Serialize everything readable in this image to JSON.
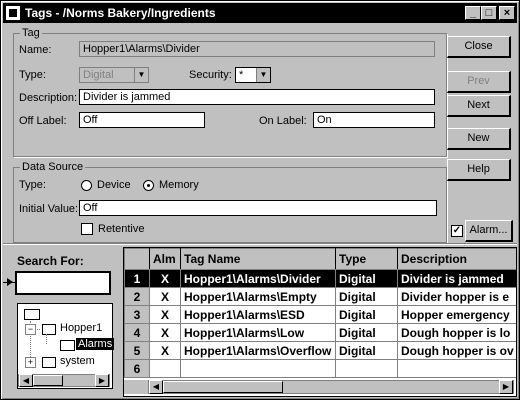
{
  "window": {
    "title": "Tags - /Norms Bakery/Ingredients",
    "minimize": "_",
    "maximize": "□",
    "close": "×"
  },
  "tag_group": {
    "title": "Tag",
    "name_label": "Name:",
    "name_value": "Hopper1\\Alarms\\Divider",
    "type_label": "Type:",
    "type_value": "Digital",
    "security_label": "Security:",
    "security_value": "*",
    "description_label": "Description:",
    "description_value": "Divider is jammed",
    "off_label": "Off Label:",
    "off_value": "Off",
    "on_label": "On Label:",
    "on_value": "On"
  },
  "data_source": {
    "title": "Data Source",
    "type_label": "Type:",
    "device_label": "Device",
    "memory_label": "Memory",
    "selected": "Memory",
    "initial_label": "Initial Value:",
    "initial_value": "Off",
    "retentive_label": "Retentive"
  },
  "buttons": {
    "close": "Close",
    "prev": "Prev",
    "next": "Next",
    "new": "New",
    "help": "Help",
    "alarm": "Alarm..."
  },
  "alarm_checked": true,
  "search": {
    "label": "Search For:",
    "value": ""
  },
  "tree": {
    "root": "",
    "hopper": "Hopper1",
    "alarms": "Alarms",
    "system": "system"
  },
  "table": {
    "headers": [
      "",
      "Alm",
      "Tag Name",
      "Type",
      "Description"
    ],
    "rows": [
      {
        "n": "1",
        "alm": "X",
        "name": "Hopper1\\Alarms\\Divider",
        "type": "Digital",
        "desc": "Divider is jammed"
      },
      {
        "n": "2",
        "alm": "X",
        "name": "Hopper1\\Alarms\\Empty",
        "type": "Digital",
        "desc": "Divider hopper is e"
      },
      {
        "n": "3",
        "alm": "X",
        "name": "Hopper1\\Alarms\\ESD",
        "type": "Digital",
        "desc": "Hopper emergency"
      },
      {
        "n": "4",
        "alm": "X",
        "name": "Hopper1\\Alarms\\Low",
        "type": "Digital",
        "desc": "Dough hopper is lo"
      },
      {
        "n": "5",
        "alm": "X",
        "name": "Hopper1\\Alarms\\Overflow",
        "type": "Digital",
        "desc": "Dough hopper is ov"
      },
      {
        "n": "6",
        "alm": "",
        "name": "",
        "type": "",
        "desc": ""
      }
    ]
  }
}
